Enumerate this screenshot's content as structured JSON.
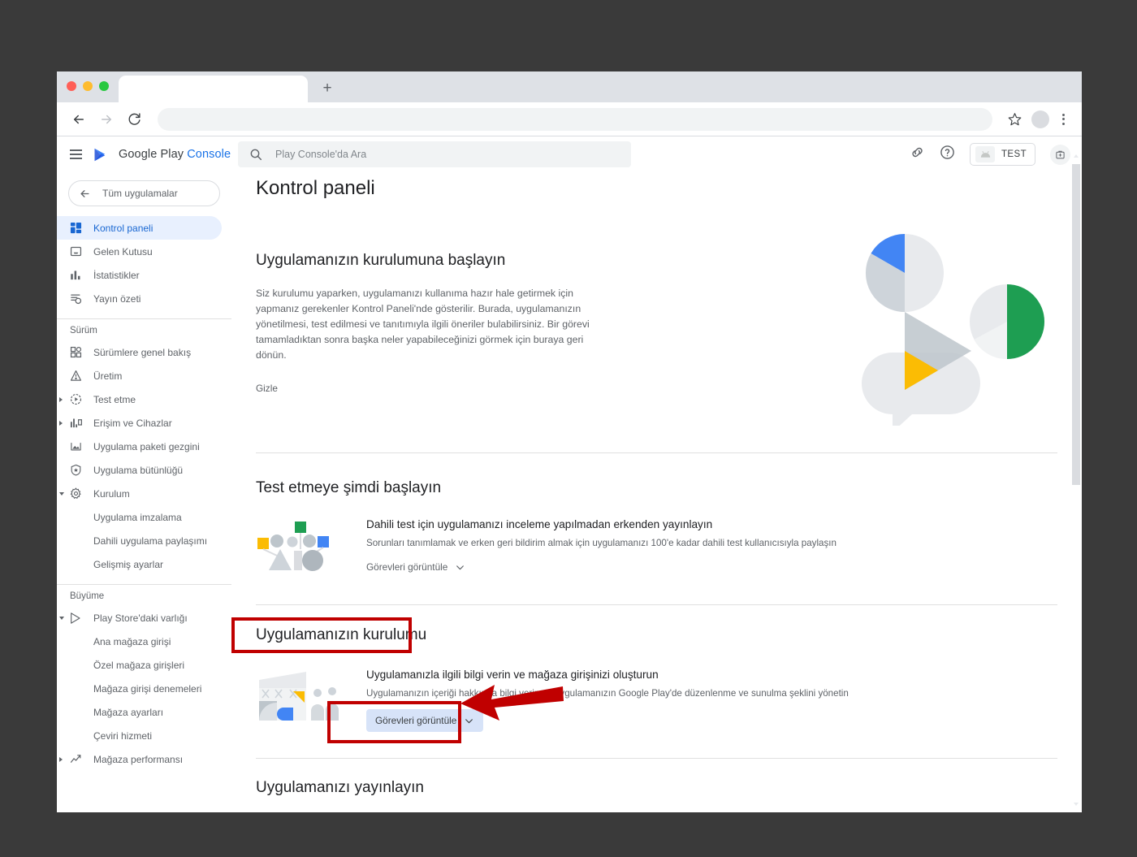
{
  "browser": {
    "tab_title": "",
    "new_tab_label": "+",
    "back_icon": "back-arrow-icon",
    "forward_icon": "forward-arrow-icon",
    "reload_icon": "reload-icon",
    "address_value": "",
    "bookmark_icon": "star-icon",
    "menu_icon": "kebab-menu-icon"
  },
  "console_header": {
    "menu_icon": "hamburger-icon",
    "brand_main": "Google Play ",
    "brand_accent": "Console",
    "search_placeholder": "Play Console'da Ara",
    "link_icon": "link-icon",
    "help_icon": "help-circle-icon",
    "test_badge_label": "TEST",
    "avatar_icon": "account-icon"
  },
  "sidebar": {
    "all_apps_label": "Tüm uygulamalar",
    "back_icon": "back-arrow-icon",
    "primary_items": [
      {
        "label": "Kontrol paneli",
        "icon": "dashboard-icon",
        "active": true
      },
      {
        "label": "Gelen Kutusu",
        "icon": "inbox-icon",
        "active": false
      },
      {
        "label": "İstatistikler",
        "icon": "statistics-icon",
        "active": false
      },
      {
        "label": "Yayın özeti",
        "icon": "publishing-overview-icon",
        "active": false
      }
    ],
    "release_section_label": "Sürüm",
    "release_items": [
      {
        "label": "Sürümlere genel bakış",
        "icon": "releases-overview-icon",
        "expandable": false
      },
      {
        "label": "Üretim",
        "icon": "production-icon",
        "expandable": false
      },
      {
        "label": "Test etme",
        "icon": "testing-icon",
        "expandable": true,
        "expanded": false
      },
      {
        "label": "Erişim ve Cihazlar",
        "icon": "reach-devices-icon",
        "expandable": true,
        "expanded": false
      },
      {
        "label": "Uygulama paketi gezgini",
        "icon": "app-bundle-explorer-icon",
        "expandable": false
      },
      {
        "label": "Uygulama bütünlüğü",
        "icon": "app-integrity-icon",
        "expandable": false
      },
      {
        "label": "Kurulum",
        "icon": "setup-gear-icon",
        "expandable": true,
        "expanded": true
      }
    ],
    "setup_subitems": [
      {
        "label": "Uygulama imzalama"
      },
      {
        "label": "Dahili uygulama paylaşımı"
      },
      {
        "label": "Gelişmiş ayarlar"
      }
    ],
    "growth_section_label": "Büyüme",
    "growth_items": [
      {
        "label": "Play Store'daki varlığı",
        "icon": "play-store-presence-icon",
        "expandable": true,
        "expanded": true
      }
    ],
    "growth_subitems": [
      {
        "label": "Ana mağaza girişi"
      },
      {
        "label": "Özel mağaza girişleri"
      },
      {
        "label": "Mağaza girişi denemeleri"
      },
      {
        "label": "Mağaza ayarları"
      },
      {
        "label": "Çeviri hizmeti"
      }
    ],
    "growth_items_2": [
      {
        "label": "Mağaza performansı",
        "icon": "store-performance-icon",
        "expandable": true,
        "expanded": false
      }
    ]
  },
  "main": {
    "page_title": "Kontrol paneli",
    "setup_start": {
      "heading": "Uygulamanızın kurulumuna başlayın",
      "body": "Siz kurulumu yaparken, uygulamanızı kullanıma hazır hale getirmek için yapmanız gerekenler Kontrol Paneli'nde gösterilir. Burada, uygulamanızın yönetilmesi, test edilmesi ve tanıtımıyla ilgili öneriler bulabilirsiniz. Bir görevi tamamladıktan sonra başka neler yapabileceğinizi görmek için buraya geri dönün.",
      "hide_label": "Gizle"
    },
    "testing_section": {
      "heading": "Test etmeye şimdi başlayın",
      "card_title": "Dahili test için uygulamanızı inceleme yapılmadan erkenden yayınlayın",
      "card_desc": "Sorunları tanımlamak ve erken geri bildirim almak için uygulamanızı 100'e kadar dahili test kullanıcısıyla paylaşın",
      "tasks_label": "Görevleri görüntüle",
      "chevron_icon": "chevron-down-icon",
      "art_icon": "people-group-illustration"
    },
    "setup_section": {
      "heading": "Uygulamanızın kurulumu",
      "card_title": "Uygulamanızla ilgili bilgi verin ve mağaza girişinizi oluşturun",
      "card_desc": "Uygulamanızın içeriği hakkında bilgi verin ve uygulamanızın Google Play'de düzenlenme ve sunulma şeklini yönetin",
      "tasks_label": "Görevleri görüntüle",
      "chevron_icon": "chevron-down-icon",
      "art_icon": "storefront-illustration"
    },
    "publish_section": {
      "heading": "Uygulamanızı yayınlayın"
    }
  },
  "annotations": {
    "highlight_color": "#c00000",
    "boxes": [
      {
        "name": "section-heading-highlight",
        "target": "Uygulamanızın kurulumu"
      },
      {
        "name": "tasks-button-highlight",
        "target": "Görevleri görüntüle"
      }
    ],
    "arrow": {
      "name": "pointer-arrow",
      "points_to": "Görevleri görüntüle"
    }
  }
}
